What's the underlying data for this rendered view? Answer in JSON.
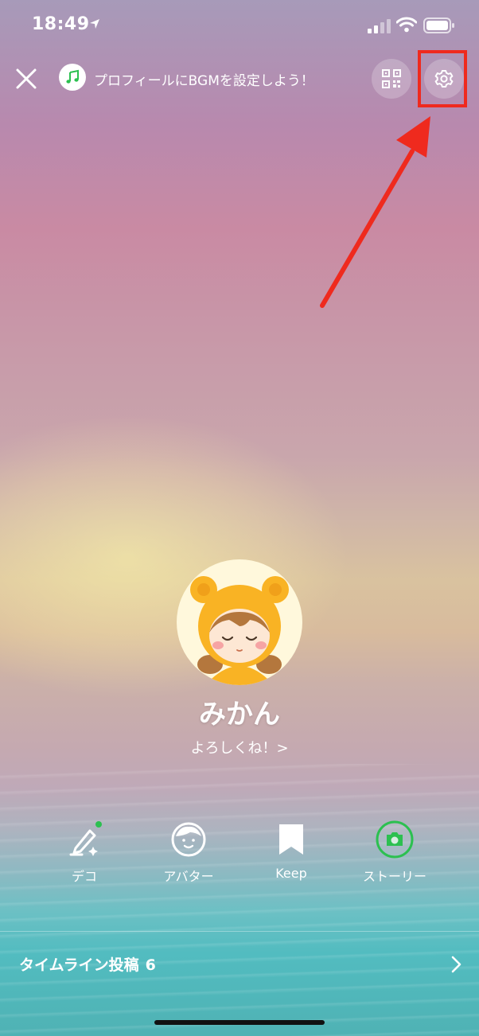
{
  "status_bar": {
    "time": "18:49"
  },
  "top_bar": {
    "bgm_prompt": "プロフィールにBGMを設定しよう！"
  },
  "profile": {
    "name": "みかん",
    "status_message": "よろしくね！>"
  },
  "actions": [
    {
      "label": "デコ",
      "icon": "pencil-sparkle-icon"
    },
    {
      "label": "アバター",
      "icon": "avatar-face-icon"
    },
    {
      "label": "Keep",
      "icon": "bookmark-icon"
    },
    {
      "label": "ストーリー",
      "icon": "camera-icon"
    }
  ],
  "timeline": {
    "label": "タイムライン投稿",
    "count": "6"
  },
  "colors": {
    "highlight": "#ef2a1e",
    "line_green": "#2cc050"
  }
}
